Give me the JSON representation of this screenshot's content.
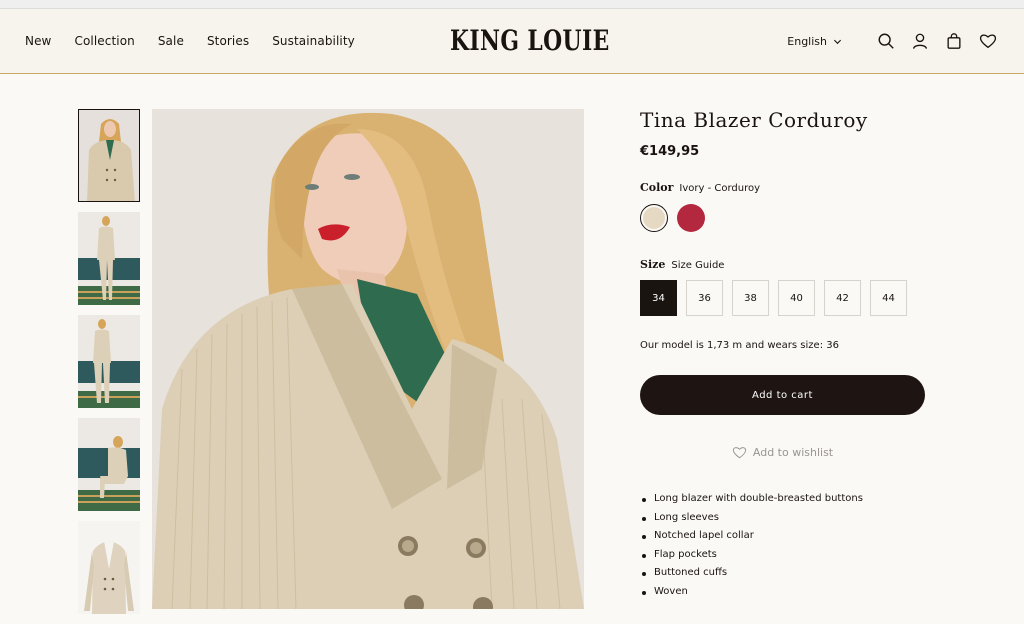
{
  "header": {
    "nav": [
      "New",
      "Collection",
      "Sale",
      "Stories",
      "Sustainability"
    ],
    "logo": "KING LOUIE",
    "language": "English",
    "icons": [
      "search-icon",
      "account-icon",
      "bag-icon",
      "heart-icon"
    ]
  },
  "gallery": {
    "thumbnail_count": 5,
    "selected_index": 0
  },
  "product": {
    "title": "Tina Blazer Corduroy",
    "price": "€149,95",
    "color_label": "Color",
    "color_value": "Ivory - Corduroy",
    "swatches": [
      {
        "name": "ivory",
        "color": "#e6d9c3",
        "selected": true
      },
      {
        "name": "red",
        "color": "#b3283f",
        "selected": false
      }
    ],
    "size_label": "Size",
    "size_guide": "Size Guide",
    "sizes": [
      "34",
      "36",
      "38",
      "40",
      "42",
      "44"
    ],
    "selected_size": "34",
    "model_note": "Our model is 1,73 m and wears size: 36",
    "add_to_cart": "Add to cart",
    "add_to_wishlist": "Add to wishlist",
    "features": [
      "Long blazer with double-breasted buttons",
      "Long sleeves",
      "Notched lapel collar",
      "Flap pockets",
      "Buttoned cuffs",
      "Woven"
    ]
  },
  "colors": {
    "accent_line": "#c9a868",
    "button": "#1e1513",
    "background": "#fbf9f5"
  }
}
